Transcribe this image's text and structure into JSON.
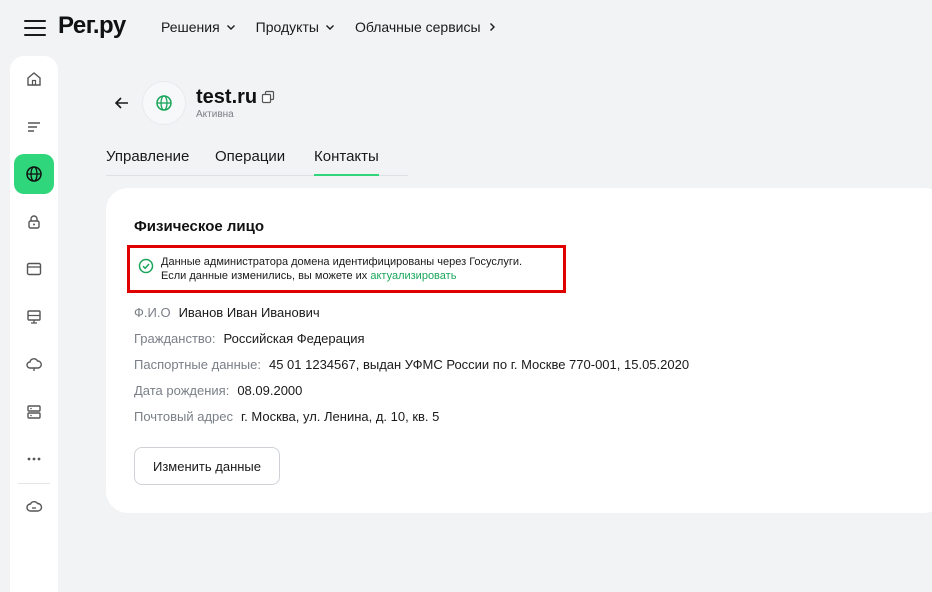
{
  "header": {
    "logo": "Рег.ру",
    "nav": [
      "Решения",
      "Продукты",
      "Облачные сервисы"
    ]
  },
  "sidebar": {
    "items": [
      {
        "icon": "home-icon"
      },
      {
        "icon": "list-icon"
      },
      {
        "icon": "globe-icon",
        "active": true
      },
      {
        "icon": "lock-icon"
      },
      {
        "icon": "browser-window-icon"
      },
      {
        "icon": "server-icon"
      },
      {
        "icon": "cloud-icon"
      },
      {
        "icon": "database-icon"
      },
      {
        "icon": "more-icon"
      },
      {
        "icon": "link-cloud-icon"
      }
    ]
  },
  "domain": {
    "name": "test.ru",
    "status": "Активна"
  },
  "tabs": [
    {
      "label": "Управление"
    },
    {
      "label": "Операции"
    },
    {
      "label": "Контакты",
      "active": true
    }
  ],
  "card": {
    "title": "Физическое лицо",
    "notice": {
      "line1": "Данные администратора домена идентифицированы через Госуслуги.",
      "line2_prefix": "Если данные изменились, вы можете их ",
      "line2_link": "актуализировать"
    },
    "fields": [
      {
        "label": "Ф.И.О",
        "value": "Иванов Иван Иванович"
      },
      {
        "label": "Гражданство:",
        "value": "Российская Федерация"
      },
      {
        "label": "Паспортные данные:",
        "value": "45 01 1234567, выдан УФМС России по г. Москве 770-001, 15.05.2020"
      },
      {
        "label": "Дата рождения:",
        "value": "08.09.2000"
      },
      {
        "label": "Почтовый адрес",
        "value": "г. Москва, ул. Ленина, д. 10, кв. 5"
      }
    ],
    "edit_button": "Изменить данные"
  },
  "colors": {
    "accent": "#2fd67b",
    "link": "#1aa65a",
    "highlight_border": "#e00000"
  }
}
